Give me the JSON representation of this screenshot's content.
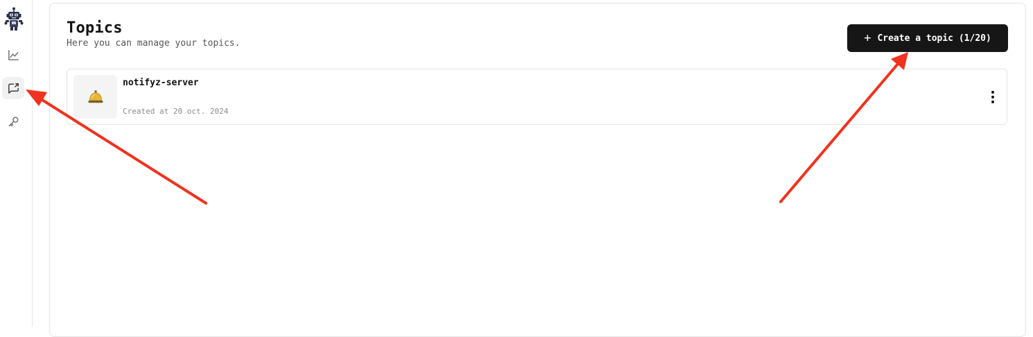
{
  "sidebar": {
    "items": [
      {
        "name": "analytics",
        "icon": "chart-line-icon",
        "active": false
      },
      {
        "name": "topics",
        "icon": "message-share-icon",
        "active": true
      },
      {
        "name": "api-keys",
        "icon": "key-icon",
        "active": false
      }
    ],
    "logo_icon": "robot-logo-icon"
  },
  "header": {
    "title": "Topics",
    "subtitle": "Here you can manage your topics.",
    "create_button": {
      "icon": "plus",
      "label": "Create a topic (1/20)"
    }
  },
  "topics": [
    {
      "name": "notifyz-server",
      "created": "Created at 20 oct. 2024",
      "icon": "bell-icon"
    }
  ],
  "annotations": {
    "arrow_color": "#f0321e"
  },
  "colors": {
    "button_bg": "#161616",
    "button_text": "#ffffff",
    "border": "#e4e4e4"
  }
}
